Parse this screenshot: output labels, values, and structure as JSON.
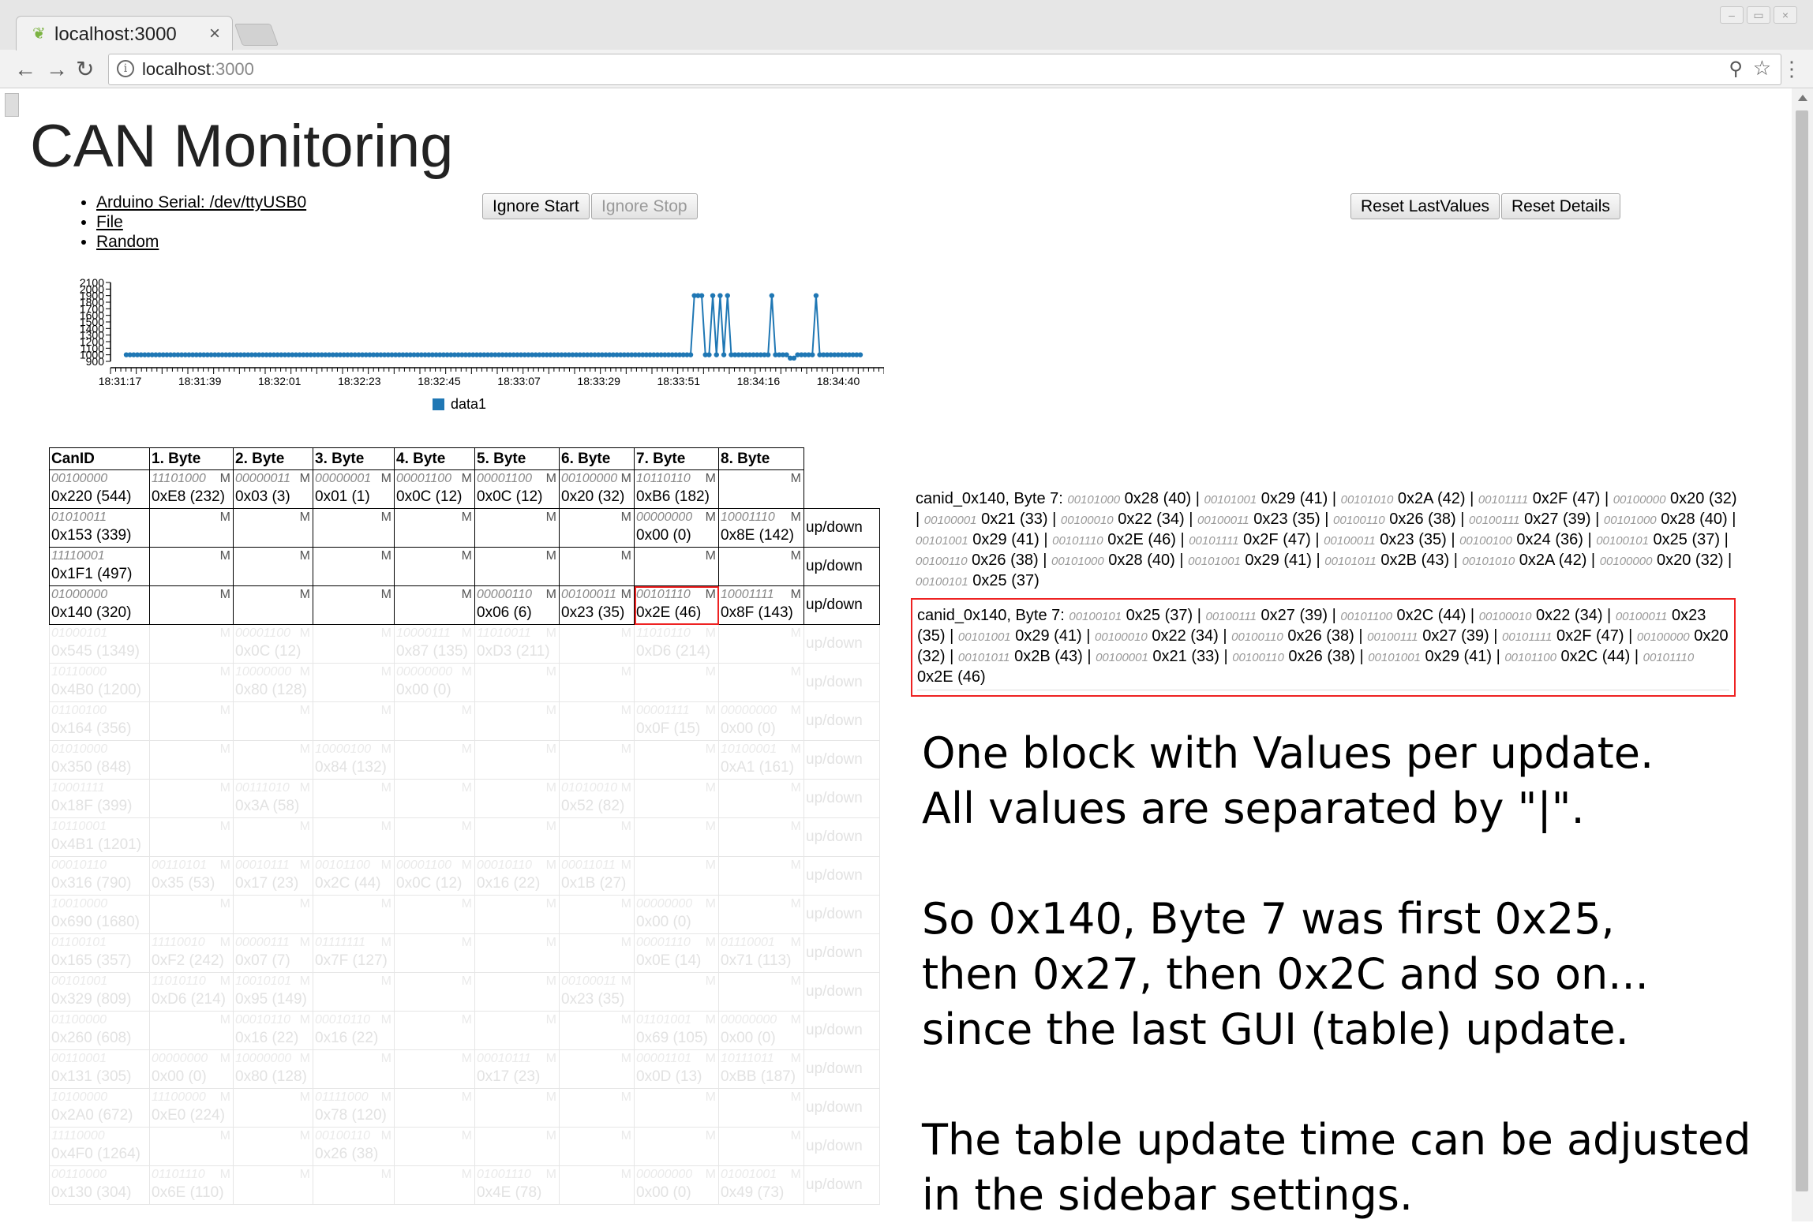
{
  "browser": {
    "tab_title": "localhost:3000",
    "url_host": "localhost",
    "url_port": ":3000"
  },
  "page": {
    "title": "CAN Monitoring",
    "links": [
      "Arduino Serial: /dev/ttyUSB0",
      "File",
      "Random"
    ],
    "buttons": {
      "ignore_start": "Ignore Start",
      "ignore_stop": "Ignore Stop",
      "reset_lastvalues": "Reset LastValues",
      "reset_details": "Reset Details"
    }
  },
  "chart_data": {
    "type": "line",
    "x": [
      "18:31:17",
      "18:31:39",
      "18:32:01",
      "18:32:23",
      "18:32:45",
      "18:33:07",
      "18:33:29",
      "18:33:51",
      "18:34:16",
      "18:34:40"
    ],
    "y_ticks": [
      900,
      1000,
      1100,
      1200,
      1300,
      1400,
      1500,
      1600,
      1700,
      1800,
      1900,
      2000,
      2100
    ],
    "ylim": [
      900,
      2100
    ],
    "series": [
      {
        "name": "data1",
        "spikes_at_fraction": [
          0.774,
          0.781,
          0.797,
          0.811,
          0.819,
          0.879,
          0.941
        ],
        "base": 1000,
        "peak": 1900,
        "dip_at_fraction": 0.907,
        "dip": 950
      }
    ],
    "legend": "bottom-center"
  },
  "table": {
    "headers": [
      "CanID",
      "1. Byte",
      "2. Byte",
      "3. Byte",
      "4. Byte",
      "5. Byte",
      "6. Byte",
      "7. Byte",
      "8. Byte"
    ],
    "updown": "up/down",
    "m": "M",
    "rows": [
      {
        "id_bin": "00100000",
        "id": "0x220 (544)",
        "cells": [
          [
            "11101000",
            "0xE8 (232)"
          ],
          [
            "00000011",
            "0x03 (3)"
          ],
          [
            "00000001",
            "0x01 (1)"
          ],
          [
            "00001100",
            "0x0C (12)"
          ],
          [
            "00001100",
            "0x0C (12)"
          ],
          [
            "00100000",
            "0x20 (32)"
          ],
          [
            "10110110",
            "0xB6 (182)"
          ],
          [
            "",
            ""
          ]
        ],
        "ud": false
      },
      {
        "id_bin": "01010011",
        "id": "0x153 (339)",
        "cells": [
          [
            "",
            ""
          ],
          [
            "",
            ""
          ],
          [
            "",
            ""
          ],
          [
            "",
            ""
          ],
          [
            "",
            ""
          ],
          [
            "",
            ""
          ],
          [
            "00000000",
            "0x00 (0)"
          ],
          [
            "10001110",
            "0x8E (142)"
          ]
        ],
        "ud": true
      },
      {
        "id_bin": "11110001",
        "id": "0x1F1 (497)",
        "cells": [
          [
            "",
            ""
          ],
          [
            "",
            ""
          ],
          [
            "",
            ""
          ],
          [
            "",
            ""
          ],
          [
            "",
            ""
          ],
          [
            "",
            ""
          ],
          [
            "",
            ""
          ],
          [
            "",
            ""
          ]
        ],
        "ud": true
      },
      {
        "id_bin": "01000000",
        "id": "0x140 (320)",
        "cells": [
          [
            "",
            ""
          ],
          [
            "",
            ""
          ],
          [
            "",
            ""
          ],
          [
            "",
            ""
          ],
          [
            "00000110",
            "0x06 (6)"
          ],
          [
            "00100011",
            "0x23 (35)"
          ],
          [
            "00101110",
            "0x2E (46)"
          ],
          [
            "10001111",
            "0x8F (143)"
          ]
        ],
        "ud": true,
        "sel": 6
      },
      {
        "id_bin": "01000101",
        "id": "0x545 (1349)",
        "cells": [
          [
            "",
            ""
          ],
          [
            "00001100",
            "0x0C (12)"
          ],
          [
            "",
            ""
          ],
          [
            "10000111",
            "0x87 (135)"
          ],
          [
            "11010011",
            "0xD3 (211)"
          ],
          [
            "",
            ""
          ],
          [
            "11010110",
            "0xD6 (214)"
          ],
          [
            "",
            ""
          ]
        ],
        "ud": true,
        "faded": true
      },
      {
        "id_bin": "10110000",
        "id": "0x4B0 (1200)",
        "cells": [
          [
            "",
            ""
          ],
          [
            "10000000",
            "0x80 (128)"
          ],
          [
            "",
            ""
          ],
          [
            "00000000",
            "0x00 (0)"
          ],
          [
            "",
            ""
          ],
          [
            "",
            ""
          ],
          [
            "",
            ""
          ],
          [
            "",
            ""
          ]
        ],
        "ud": true,
        "faded": true
      },
      {
        "id_bin": "01100100",
        "id": "0x164 (356)",
        "cells": [
          [
            "",
            ""
          ],
          [
            "",
            ""
          ],
          [
            "",
            ""
          ],
          [
            "",
            ""
          ],
          [
            "",
            ""
          ],
          [
            "",
            ""
          ],
          [
            "00001111",
            "0x0F (15)"
          ],
          [
            "00000000",
            "0x00 (0)"
          ]
        ],
        "ud": true,
        "faded": true
      },
      {
        "id_bin": "01010000",
        "id": "0x350 (848)",
        "cells": [
          [
            "",
            ""
          ],
          [
            "",
            ""
          ],
          [
            "10000100",
            "0x84 (132)"
          ],
          [
            "",
            ""
          ],
          [
            "",
            ""
          ],
          [
            "",
            ""
          ],
          [
            "",
            ""
          ],
          [
            "10100001",
            "0xA1 (161)"
          ]
        ],
        "ud": true,
        "faded": true
      },
      {
        "id_bin": "10001111",
        "id": "0x18F (399)",
        "cells": [
          [
            "",
            ""
          ],
          [
            "00111010",
            "0x3A (58)"
          ],
          [
            "",
            ""
          ],
          [
            "",
            ""
          ],
          [
            "",
            ""
          ],
          [
            "01010010",
            "0x52 (82)"
          ],
          [
            "",
            ""
          ],
          [
            "",
            ""
          ]
        ],
        "ud": true,
        "faded": true
      },
      {
        "id_bin": "10110001",
        "id": "0x4B1 (1201)",
        "cells": [
          [
            "",
            ""
          ],
          [
            "",
            ""
          ],
          [
            "",
            ""
          ],
          [
            "",
            ""
          ],
          [
            "",
            ""
          ],
          [
            "",
            ""
          ],
          [
            "",
            ""
          ],
          [
            "",
            ""
          ]
        ],
        "ud": true,
        "faded": true
      },
      {
        "id_bin": "00010110",
        "id": "0x316 (790)",
        "cells": [
          [
            "00110101",
            "0x35 (53)"
          ],
          [
            "00010111",
            "0x17 (23)"
          ],
          [
            "00101100",
            "0x2C (44)"
          ],
          [
            "00001100",
            "0x0C (12)"
          ],
          [
            "00010110",
            "0x16 (22)"
          ],
          [
            "00011011",
            "0x1B (27)"
          ],
          [
            "",
            ""
          ],
          [
            "",
            ""
          ]
        ],
        "ud": true,
        "faded": true
      },
      {
        "id_bin": "10010000",
        "id": "0x690 (1680)",
        "cells": [
          [
            "",
            ""
          ],
          [
            "",
            ""
          ],
          [
            "",
            ""
          ],
          [
            "",
            ""
          ],
          [
            "",
            ""
          ],
          [
            "",
            ""
          ],
          [
            "00000000",
            "0x00 (0)"
          ],
          [
            "",
            ""
          ]
        ],
        "ud": true,
        "faded": true
      },
      {
        "id_bin": "01100101",
        "id": "0x165 (357)",
        "cells": [
          [
            "11110010",
            "0xF2 (242)"
          ],
          [
            "00000111",
            "0x07 (7)"
          ],
          [
            "01111111",
            "0x7F (127)"
          ],
          [
            "",
            ""
          ],
          [
            "",
            ""
          ],
          [
            "",
            ""
          ],
          [
            "00001110",
            "0x0E (14)"
          ],
          [
            "01110001",
            "0x71 (113)"
          ]
        ],
        "ud": true,
        "faded": true
      },
      {
        "id_bin": "00101001",
        "id": "0x329 (809)",
        "cells": [
          [
            "11010110",
            "0xD6 (214)"
          ],
          [
            "10010101",
            "0x95 (149)"
          ],
          [
            "",
            ""
          ],
          [
            "",
            ""
          ],
          [
            "",
            ""
          ],
          [
            "00100011",
            "0x23 (35)"
          ],
          [
            "",
            ""
          ],
          [
            "",
            ""
          ]
        ],
        "ud": true,
        "faded": true
      },
      {
        "id_bin": "01100000",
        "id": "0x260 (608)",
        "cells": [
          [
            "",
            ""
          ],
          [
            "00010110",
            "0x16 (22)"
          ],
          [
            "00010110",
            "0x16 (22)"
          ],
          [
            "",
            ""
          ],
          [
            "",
            ""
          ],
          [
            "",
            ""
          ],
          [
            "01101001",
            "0x69 (105)"
          ],
          [
            "00000000",
            "0x00 (0)"
          ]
        ],
        "ud": true,
        "faded": true
      },
      {
        "id_bin": "00110001",
        "id": "0x131 (305)",
        "cells": [
          [
            "00000000",
            "0x00 (0)"
          ],
          [
            "10000000",
            "0x80 (128)"
          ],
          [
            "",
            ""
          ],
          [
            "",
            ""
          ],
          [
            "00010111",
            "0x17 (23)"
          ],
          [
            "",
            ""
          ],
          [
            "00001101",
            "0x0D (13)"
          ],
          [
            "10111011",
            "0xBB (187)"
          ]
        ],
        "ud": true,
        "faded": true
      },
      {
        "id_bin": "10100000",
        "id": "0x2A0 (672)",
        "cells": [
          [
            "11100000",
            "0xE0 (224)"
          ],
          [
            "",
            ""
          ],
          [
            "01111000",
            "0x78 (120)"
          ],
          [
            "",
            ""
          ],
          [
            "",
            ""
          ],
          [
            "",
            ""
          ],
          [
            "",
            ""
          ],
          [
            "",
            ""
          ]
        ],
        "ud": true,
        "faded": true
      },
      {
        "id_bin": "11110000",
        "id": "0x4F0 (1264)",
        "cells": [
          [
            "",
            ""
          ],
          [
            "",
            ""
          ],
          [
            "00100110",
            "0x26 (38)"
          ],
          [
            "",
            ""
          ],
          [
            "",
            ""
          ],
          [
            "",
            ""
          ],
          [
            "",
            ""
          ],
          [
            "",
            ""
          ]
        ],
        "ud": true,
        "faded": true
      },
      {
        "id_bin": "00110000",
        "id": "0x130 (304)",
        "cells": [
          [
            "01101110",
            "0x6E (110)"
          ],
          [
            "",
            ""
          ],
          [
            "",
            ""
          ],
          [
            "",
            ""
          ],
          [
            "01001110",
            "0x4E (78)"
          ],
          [
            "",
            ""
          ],
          [
            "00000000",
            "0x00 (0)"
          ],
          [
            "01001001",
            "0x49 (73)"
          ]
        ],
        "ud": true,
        "faded": true
      }
    ]
  },
  "details": [
    {
      "label": "canid_0x140, Byte 7:",
      "values": [
        [
          "00101000",
          "0x28 (40)"
        ],
        [
          "00101001",
          "0x29 (41)"
        ],
        [
          "00101010",
          "0x2A (42)"
        ],
        [
          "00101111",
          "0x2F (47)"
        ],
        [
          "00100000",
          "0x20 (32)"
        ],
        [
          "00100001",
          "0x21 (33)"
        ],
        [
          "00100010",
          "0x22 (34)"
        ],
        [
          "00100011",
          "0x23 (35)"
        ],
        [
          "00100110",
          "0x26 (38)"
        ],
        [
          "00100111",
          "0x27 (39)"
        ],
        [
          "00101000",
          "0x28 (40)"
        ],
        [
          "00101001",
          "0x29 (41)"
        ],
        [
          "00101110",
          "0x2E (46)"
        ],
        [
          "00101111",
          "0x2F (47)"
        ],
        [
          "00100011",
          "0x23 (35)"
        ],
        [
          "00100100",
          "0x24 (36)"
        ],
        [
          "00100101",
          "0x25 (37)"
        ],
        [
          "00100110",
          "0x26 (38)"
        ],
        [
          "00101000",
          "0x28 (40)"
        ],
        [
          "00101001",
          "0x29 (41)"
        ],
        [
          "00101011",
          "0x2B (43)"
        ],
        [
          "00101010",
          "0x2A (42)"
        ],
        [
          "00100000",
          "0x20 (32)"
        ],
        [
          "00100101",
          "0x25 (37)"
        ]
      ]
    },
    {
      "label": "canid_0x140, Byte 7:",
      "values": [
        [
          "00100101",
          "0x25 (37)"
        ],
        [
          "00100111",
          "0x27 (39)"
        ],
        [
          "00101100",
          "0x2C (44)"
        ],
        [
          "00100010",
          "0x22 (34)"
        ],
        [
          "00100011",
          "0x23 (35)"
        ],
        [
          "00101001",
          "0x29 (41)"
        ],
        [
          "00100010",
          "0x22 (34)"
        ],
        [
          "00100110",
          "0x26 (38)"
        ],
        [
          "00100111",
          "0x27 (39)"
        ],
        [
          "00101111",
          "0x2F (47)"
        ],
        [
          "00100000",
          "0x20 (32)"
        ],
        [
          "00101011",
          "0x2B (43)"
        ],
        [
          "00100001",
          "0x21 (33)"
        ],
        [
          "00100110",
          "0x26 (38)"
        ],
        [
          "00101001",
          "0x29 (41)"
        ],
        [
          "00101100",
          "0x2C (44)"
        ],
        [
          "00101110",
          "0x2E (46)"
        ]
      ]
    }
  ],
  "annotation": "One block with Values per update.\nAll values are separated by \"|\".\n\nSo 0x140, Byte 7 was first 0x25,\nthen 0x27, then 0x2C and so on...\nsince the last GUI (table) update.\n\nThe table update time can be adjusted\nin the sidebar settings."
}
